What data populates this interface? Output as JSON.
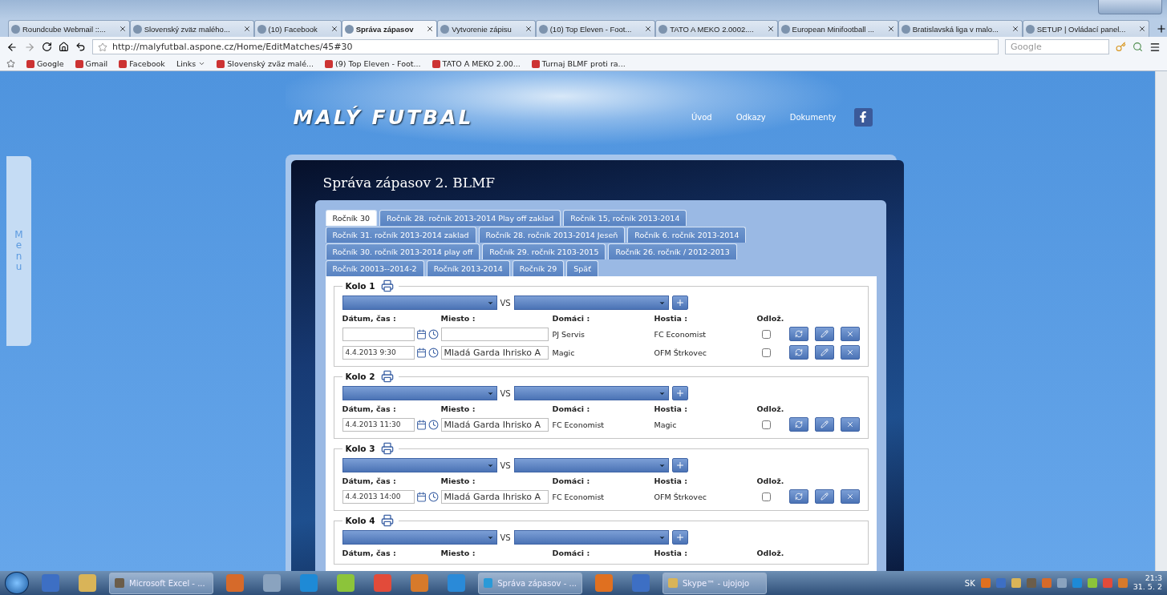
{
  "browser": {
    "tabs": [
      {
        "title": "Roundcube Webmail ::...",
        "selected": false
      },
      {
        "title": "Slovenský zväz malého...",
        "selected": false
      },
      {
        "title": "(10) Facebook",
        "selected": false
      },
      {
        "title": "Správa zápasov",
        "selected": true
      },
      {
        "title": "Vytvorenie zápisu",
        "selected": false
      },
      {
        "title": "(10) Top Eleven - Foot...",
        "selected": false
      },
      {
        "title": "TATO A MEKO 2.0002....",
        "selected": false
      },
      {
        "title": "European Minifootball ...",
        "selected": false
      },
      {
        "title": "Bratislavská liga v malo...",
        "selected": false
      },
      {
        "title": "SETUP | Ovládací panel...",
        "selected": false
      }
    ],
    "url": "http://malyfutbal.aspone.cz/Home/EditMatches/45#30",
    "search": {
      "placeholder": "Google"
    },
    "bookmarks": [
      {
        "label": "Google",
        "kind": "link"
      },
      {
        "label": "Gmail",
        "kind": "link"
      },
      {
        "label": "Facebook",
        "kind": "link"
      },
      {
        "label": "Links",
        "kind": "folder"
      },
      {
        "label": "Slovenský zväz malé...",
        "kind": "link"
      },
      {
        "label": "(9) Top Eleven - Foot...",
        "kind": "link"
      },
      {
        "label": "TATO A MEKO 2.00...",
        "kind": "link"
      },
      {
        "label": "Turnaj BLMF proti ra...",
        "kind": "link"
      }
    ]
  },
  "side_menu": {
    "label": "Menu"
  },
  "site": {
    "logo": "MALÝ FUTBAL",
    "nav": [
      "Úvod",
      "Odkazy",
      "Dokumenty"
    ],
    "title": "Správa zápasov 2. BLMF",
    "season_tabs": [
      {
        "label": "Ročník 30",
        "selected": true
      },
      {
        "label": "Ročník 28. ročník 2013-2014 Play off zaklad",
        "selected": false
      },
      {
        "label": "Ročník 15, ročník 2013-2014",
        "selected": false
      },
      {
        "label": "Ročník 31. ročník 2013-2014 zaklad",
        "selected": false
      },
      {
        "label": "Ročník 28. ročník 2013-2014 Jeseň",
        "selected": false
      },
      {
        "label": "Ročník 6. ročník 2013-2014",
        "selected": false
      },
      {
        "label": "Ročník 30. ročník 2013-2014 play off",
        "selected": false
      },
      {
        "label": "Ročník 29. ročník 2103-2015",
        "selected": false
      },
      {
        "label": "Ročník 26. ročník / 2012-2013",
        "selected": false
      },
      {
        "label": "Ročník 20013--2014-2",
        "selected": false
      },
      {
        "label": "Ročník 2013-2014",
        "selected": false
      },
      {
        "label": "Ročník 29",
        "selected": false
      },
      {
        "label": "Späť",
        "selected": false
      }
    ],
    "rounds": [
      {
        "title": "Kolo 1",
        "vs": "VS",
        "columns": [
          "Dátum, čas :",
          "Miesto :",
          "Domáci :",
          "Hostia :",
          "Odlož."
        ],
        "matches": [
          {
            "home": "PJ Servis",
            "away": "FC Economist",
            "postponed": false
          },
          {
            "date": "4.4.2013 9:30",
            "place": "Mladá Garda Ihrisko A",
            "home": "Magic",
            "away": "OFM Štrkovec",
            "postponed": false
          }
        ]
      },
      {
        "title": "Kolo 2",
        "vs": "VS",
        "columns": [
          "Dátum, čas :",
          "Miesto :",
          "Domáci :",
          "Hostia :",
          "Odlož."
        ],
        "matches": [
          {
            "date": "4.4.2013 11:30",
            "place": "Mladá Garda Ihrisko A",
            "home": "FC Economist",
            "away": "Magic",
            "postponed": false
          }
        ]
      },
      {
        "title": "Kolo 3",
        "vs": "VS",
        "columns": [
          "Dátum, čas :",
          "Miesto :",
          "Domáci :",
          "Hostia :",
          "Odlož."
        ],
        "matches": [
          {
            "date": "4.4.2013 14:00",
            "place": "Mladá Garda Ihrisko A",
            "home": "FC Economist",
            "away": "OFM Štrkovec",
            "postponed": false
          }
        ]
      },
      {
        "title": "Kolo 4",
        "vs": "VS",
        "columns": [
          "Dátum, čas :",
          "Miesto :",
          "Domáci :",
          "Hostia :",
          "Odlož."
        ]
      }
    ]
  },
  "taskbar": {
    "items": [
      {
        "kind": "start"
      },
      {
        "kind": "app"
      },
      {
        "kind": "app"
      },
      {
        "kind": "window",
        "label": "Microsoft Excel - ..."
      },
      {
        "kind": "app"
      },
      {
        "kind": "app"
      },
      {
        "kind": "app"
      },
      {
        "kind": "app"
      },
      {
        "kind": "app"
      },
      {
        "kind": "app"
      },
      {
        "kind": "app"
      },
      {
        "kind": "window",
        "label": "Správa zápasov - ..."
      },
      {
        "kind": "app"
      },
      {
        "kind": "app"
      },
      {
        "kind": "window",
        "label": "Skype™ - ujojojo"
      }
    ],
    "language": "SK",
    "time": "21:3",
    "date": "31. 5. 2"
  }
}
